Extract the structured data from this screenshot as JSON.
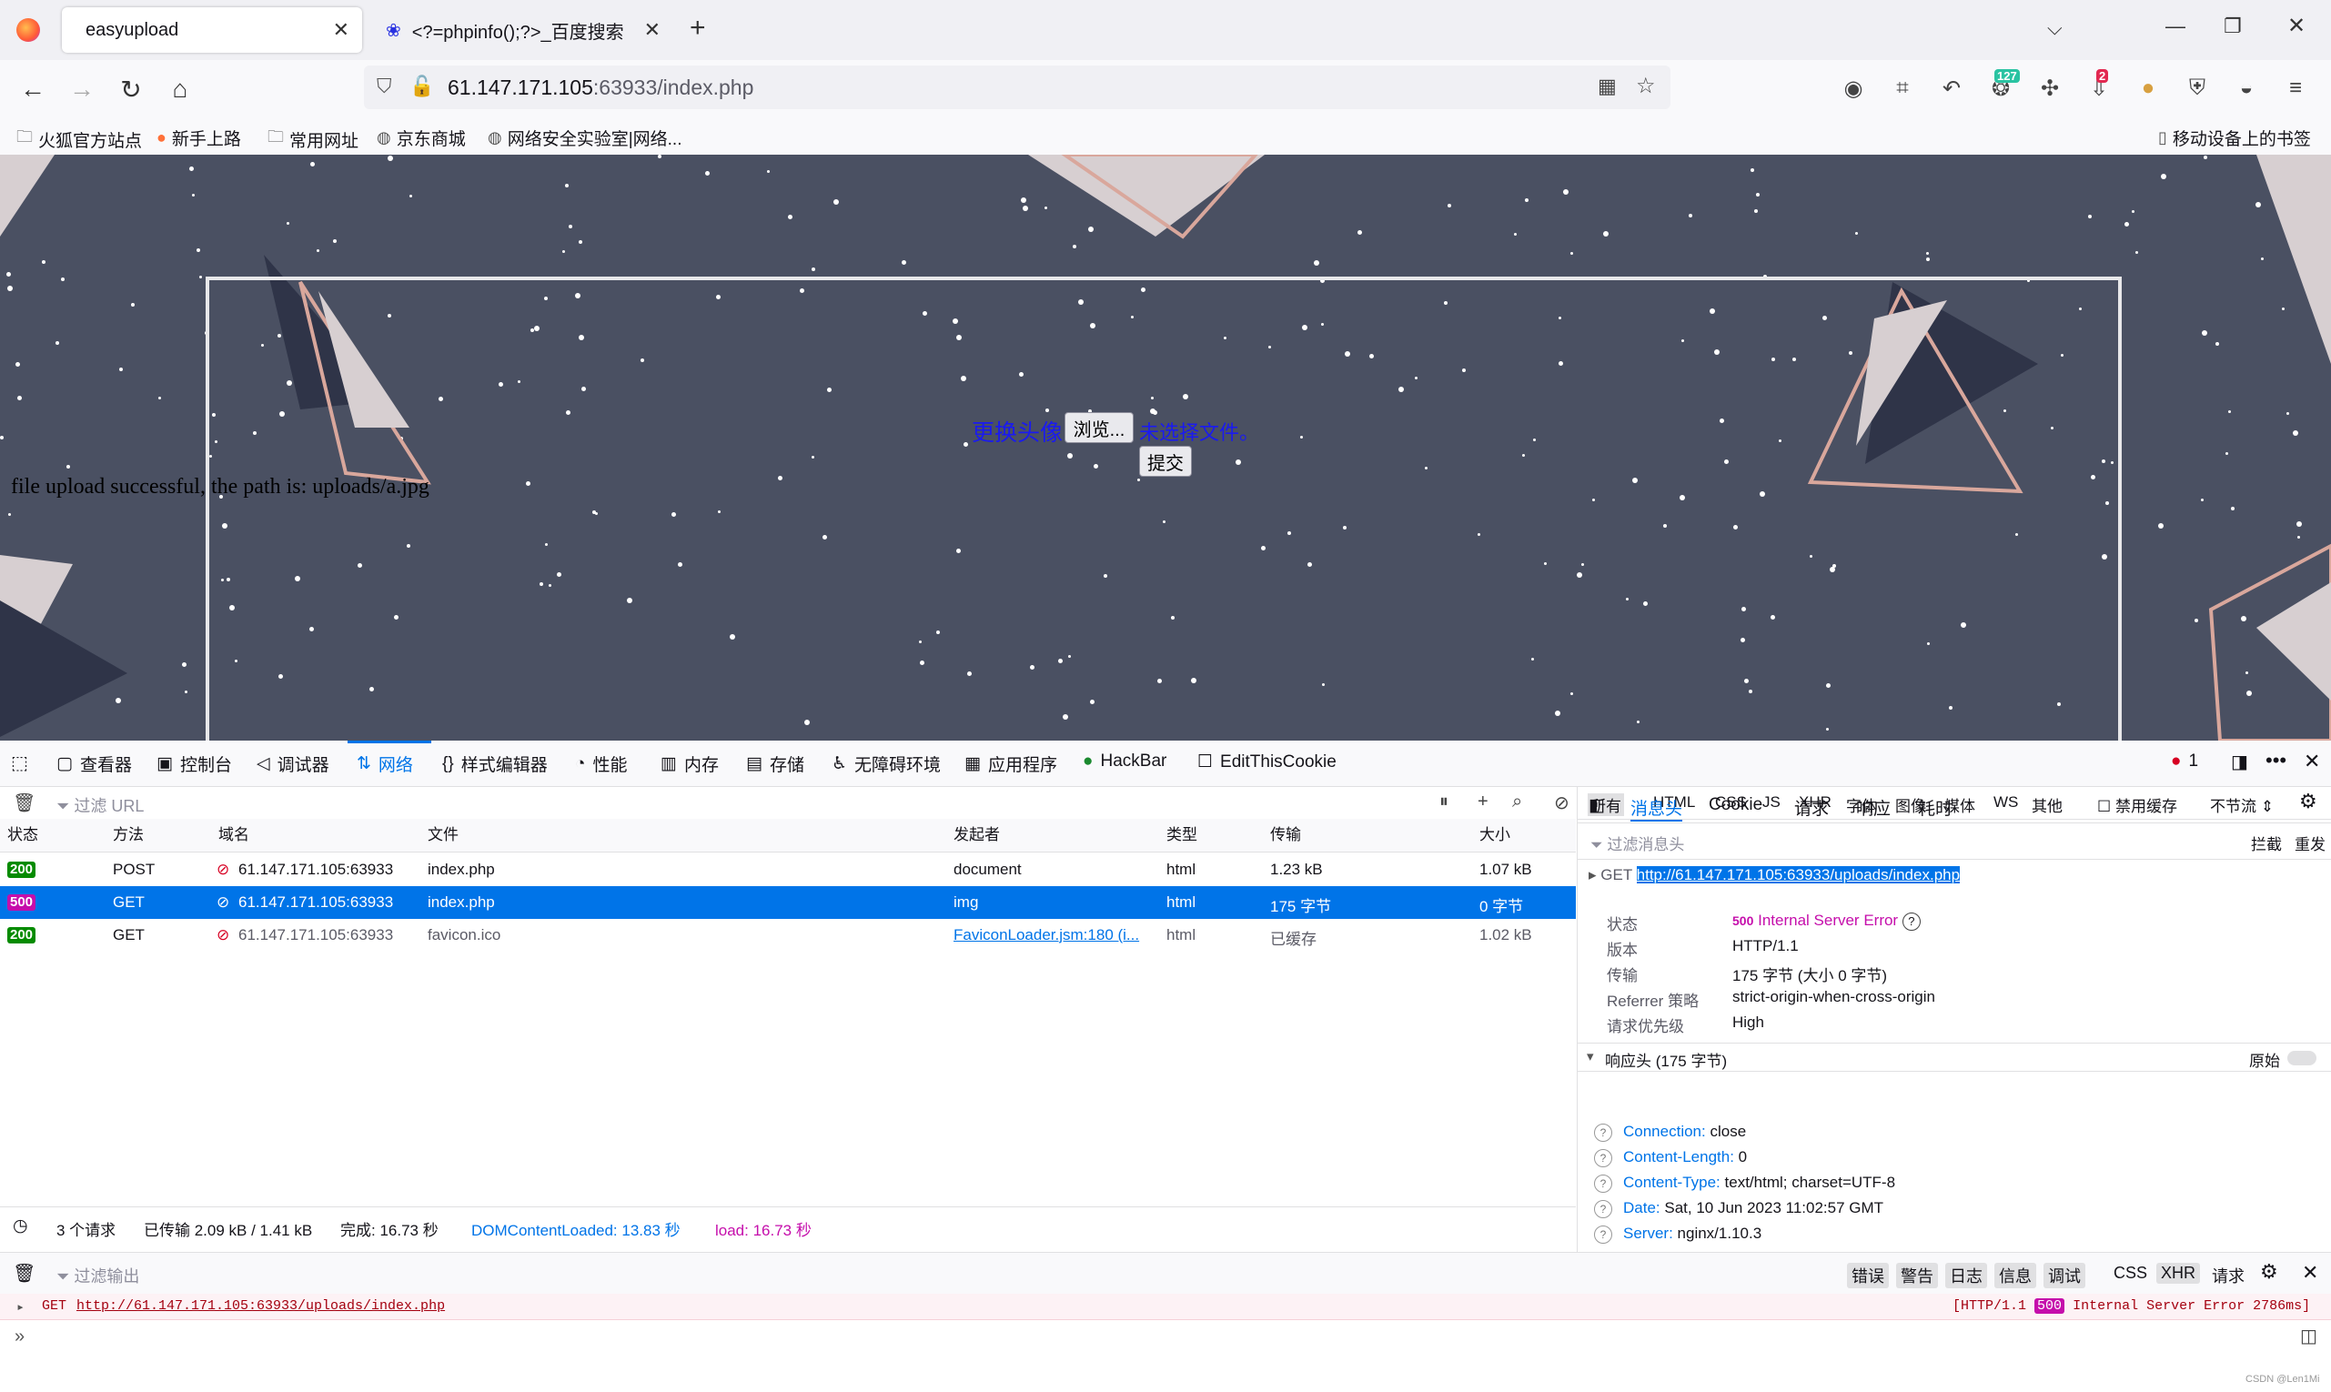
{
  "tabs": [
    {
      "title": "easyupload",
      "active": true
    },
    {
      "title": "<?=phpinfo();?>_百度搜索",
      "active": false
    }
  ],
  "url": {
    "host": "61.147.171.105",
    "rest": ":63933/index.php"
  },
  "toolbar_badges": {
    "first": "127",
    "second": "2"
  },
  "bookmarks": [
    "火狐官方站点",
    "新手上路",
    "常用网址",
    "京东商城",
    "网络安全实验室|网络..."
  ],
  "mobile_bookmarks": "移动设备上的书签",
  "page": {
    "success_text": "file upload successful, the path is: uploads/a.jpg",
    "upload_label": "更换头像",
    "browse_button": "浏览...",
    "no_file_text": "未选择文件。",
    "submit_button": "提交"
  },
  "devtools": {
    "tabs": [
      "查看器",
      "控制台",
      "调试器",
      "网络",
      "样式编辑器",
      "性能",
      "内存",
      "存储",
      "无障碍环境",
      "应用程序",
      "HackBar",
      "EditThisCookie"
    ],
    "error_count": "1",
    "filter_url_placeholder": "过滤 URL",
    "type_filters": [
      "所有",
      "HTML",
      "CSS",
      "JS",
      "XHR",
      "字体",
      "图像",
      "媒体",
      "WS",
      "其他"
    ],
    "disable_cache": "禁用缓存",
    "throttle": "不节流 ⇕",
    "columns": [
      "状态",
      "方法",
      "域名",
      "文件",
      "发起者",
      "类型",
      "传输",
      "大小"
    ],
    "rows": [
      {
        "status": "200",
        "method": "POST",
        "domain": "61.147.171.105:63933",
        "file": "index.php",
        "initiator": "document",
        "type": "html",
        "transfer": "1.23 kB",
        "size": "1.07 kB"
      },
      {
        "status": "500",
        "method": "GET",
        "domain": "61.147.171.105:63933",
        "file": "index.php",
        "initiator": "img",
        "type": "html",
        "transfer": "175 字节",
        "size": "0 字节"
      },
      {
        "status": "200",
        "method": "GET",
        "domain": "61.147.171.105:63933",
        "file": "favicon.ico",
        "initiator": "FaviconLoader.jsm:180 (i...",
        "type": "html",
        "transfer": "已缓存",
        "size": "1.02 kB"
      }
    ],
    "summary": {
      "requests": "3 个请求",
      "transferred": "已传输 2.09 kB / 1.41 kB",
      "finish": "完成:  16.73 秒",
      "dcl": "DOMContentLoaded: 13.83 秒",
      "load": "load: 16.73 秒"
    },
    "side": {
      "tabs": [
        "消息头",
        "Cookie",
        "请求",
        "响应",
        "耗时"
      ],
      "filter_placeholder": "过滤消息头",
      "block": "拦截",
      "resend": "重发",
      "request_method": "GET",
      "request_url": "http://61.147.171.105:63933/uploads/index.php",
      "status_label": "状态",
      "status_code": "500",
      "status_text": "Internal Server Error",
      "version_label": "版本",
      "version": "HTTP/1.1",
      "transfer_label": "传输",
      "transfer": "175 字节 (大小 0 字节)",
      "referrer_label": "Referrer 策略",
      "referrer": "strict-origin-when-cross-origin",
      "priority_label": "请求优先级",
      "priority": "High",
      "response_headers_title": "响应头 (175 字节)",
      "raw_label": "原始",
      "headers": [
        {
          "name": "Connection:",
          "value": "close"
        },
        {
          "name": "Content-Length:",
          "value": "0"
        },
        {
          "name": "Content-Type:",
          "value": "text/html; charset=UTF-8"
        },
        {
          "name": "Date:",
          "value": "Sat, 10 Jun 2023 11:02:57 GMT"
        },
        {
          "name": "Server:",
          "value": "nginx/1.10.3"
        }
      ]
    },
    "console": {
      "filter_placeholder": "过滤输出",
      "levels": [
        "错误",
        "警告",
        "日志",
        "信息",
        "调试"
      ],
      "extra": [
        "CSS",
        "XHR",
        "请求"
      ],
      "line_method": "GET",
      "line_url": "http://61.147.171.105:63933/uploads/index.php",
      "line_status_prefix": "[HTTP/1.1",
      "line_status_code": "500",
      "line_status_suffix": "Internal Server Error 2786ms]",
      "watermark": "CSDN @Len1Mi"
    }
  }
}
